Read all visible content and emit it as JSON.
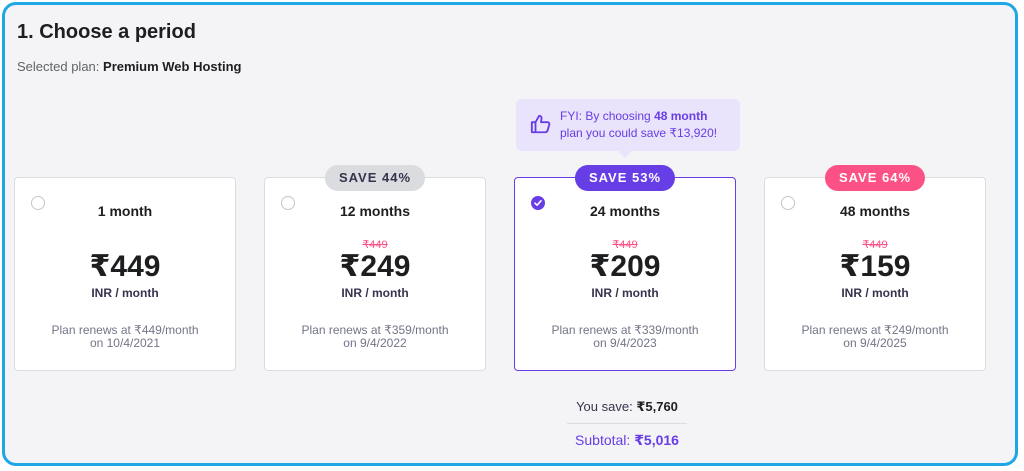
{
  "header": {
    "title": "1. Choose a period",
    "selected_prefix": "Selected plan:",
    "selected_plan": "Premium Web Hosting"
  },
  "tooltip": {
    "icon": "thumbs-up-icon",
    "fyi": "FYI:",
    "text_a": "By choosing",
    "highlight": "48 month",
    "text_b": "plan you could save ₹13,920!"
  },
  "plans": [
    {
      "period": "1 month",
      "badge": "",
      "old_price": "",
      "price": "₹449",
      "unit": "INR / month",
      "renew_1": "Plan renews at ₹449/month",
      "renew_2": "on 10/4/2021",
      "selected": false
    },
    {
      "period": "12 months",
      "badge": "SAVE 44%",
      "old_price": "₹449",
      "price": "₹249",
      "unit": "INR / month",
      "renew_1": "Plan renews at ₹359/month",
      "renew_2": "on 9/4/2022",
      "selected": false
    },
    {
      "period": "24 months",
      "badge": "SAVE 53%",
      "old_price": "₹449",
      "price": "₹209",
      "unit": "INR / month",
      "renew_1": "Plan renews at ₹339/month",
      "renew_2": "on 9/4/2023",
      "selected": true
    },
    {
      "period": "48 months",
      "badge": "SAVE 64%",
      "old_price": "₹449",
      "price": "₹159",
      "unit": "INR / month",
      "renew_1": "Plan renews at ₹249/month",
      "renew_2": "on 9/4/2025",
      "selected": false
    }
  ],
  "summary": {
    "save_label": "You save:",
    "save_value": "₹5,760",
    "subtotal_label": "Subtotal:",
    "subtotal_value": "₹5,016"
  },
  "colors": {
    "accent": "#673de6",
    "pink": "#fc5185",
    "frame_border": "#1ea7e4"
  }
}
